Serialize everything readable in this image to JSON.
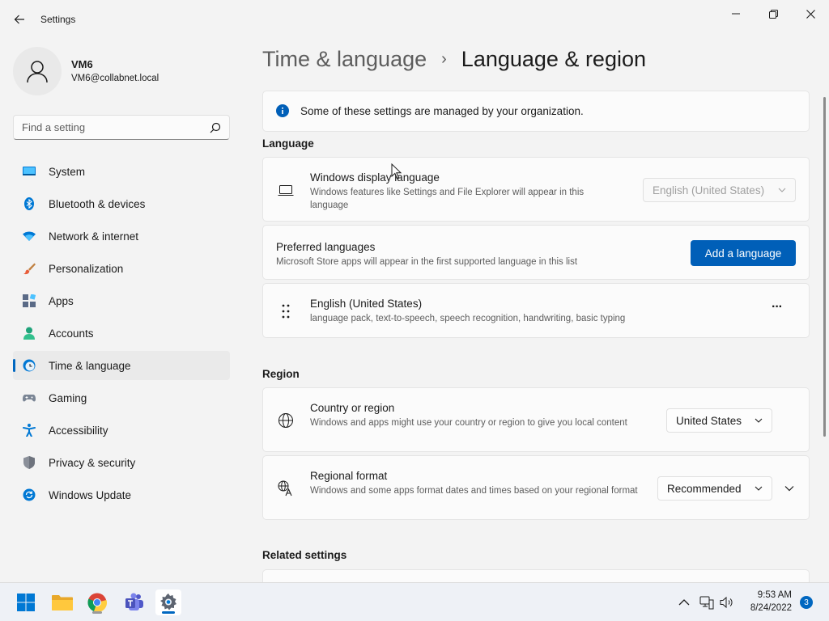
{
  "window": {
    "title": "Settings",
    "controls": [
      "minimize",
      "restore",
      "close"
    ]
  },
  "user": {
    "name": "VM6",
    "email": "VM6@collabnet.local"
  },
  "search": {
    "placeholder": "Find a setting"
  },
  "sidebar": {
    "items": [
      {
        "label": "System",
        "icon": "system-icon"
      },
      {
        "label": "Bluetooth & devices",
        "icon": "bluetooth-icon"
      },
      {
        "label": "Network & internet",
        "icon": "wifi-icon"
      },
      {
        "label": "Personalization",
        "icon": "brush-icon"
      },
      {
        "label": "Apps",
        "icon": "apps-icon"
      },
      {
        "label": "Accounts",
        "icon": "person-icon"
      },
      {
        "label": "Time & language",
        "icon": "clock-globe-icon",
        "active": true
      },
      {
        "label": "Gaming",
        "icon": "gamepad-icon"
      },
      {
        "label": "Accessibility",
        "icon": "accessibility-icon"
      },
      {
        "label": "Privacy & security",
        "icon": "shield-icon"
      },
      {
        "label": "Windows Update",
        "icon": "update-icon"
      }
    ]
  },
  "breadcrumb": {
    "parent": "Time & language",
    "separator": "›",
    "current": "Language & region"
  },
  "notice": {
    "text": "Some of these settings are managed by your organization."
  },
  "language_section": {
    "header": "Language",
    "display_language": {
      "title": "Windows display language",
      "description": "Windows features like Settings and File Explorer will appear in this language",
      "value": "English (United States)"
    },
    "preferred": {
      "title": "Preferred languages",
      "description": "Microsoft Store apps will appear in the first supported language in this list",
      "button": "Add a language"
    },
    "installed": {
      "title": "English (United States)",
      "description": "language pack, text-to-speech, speech recognition, handwriting, basic typing",
      "more": "···"
    }
  },
  "region_section": {
    "header": "Region",
    "country": {
      "title": "Country or region",
      "description": "Windows and apps might use your country or region to give you local content",
      "value": "United States"
    },
    "format": {
      "title": "Regional format",
      "description": "Windows and some apps format dates and times based on your regional format",
      "value": "Recommended"
    }
  },
  "related": {
    "header": "Related settings"
  },
  "taskbar": {
    "time": "9:53 AM",
    "date": "8/24/2022",
    "notifications": "3",
    "apps": [
      "start-icon",
      "file-explorer-icon",
      "chrome-icon",
      "teams-icon",
      "settings-icon"
    ]
  },
  "colors": {
    "accent": "#005fb8",
    "background": "#f3f3f3",
    "card": "#fbfbfb"
  }
}
